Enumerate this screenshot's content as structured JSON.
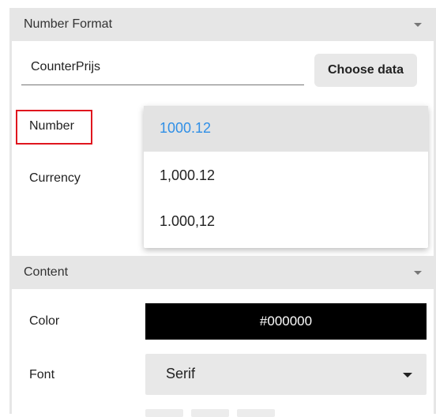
{
  "number_format": {
    "header": "Number Format",
    "field_value": "CounterPrijs",
    "choose_data_label": "Choose data",
    "number_label": "Number",
    "currency_label": "Currency",
    "dropdown_options": [
      "1000.12",
      "1,000.12",
      "1.000,12"
    ],
    "selected_option": "1000.12"
  },
  "content": {
    "header": "Content",
    "color_label": "Color",
    "color_value": "#000000",
    "font_label": "Font",
    "font_value": "Serif"
  },
  "colors": {
    "selected_text": "#2f8fe6",
    "highlight_border": "#e0161e",
    "header_bg": "#e6e6e6"
  },
  "icons": [
    "chevron-down-icon",
    "caret-down-icon"
  ]
}
